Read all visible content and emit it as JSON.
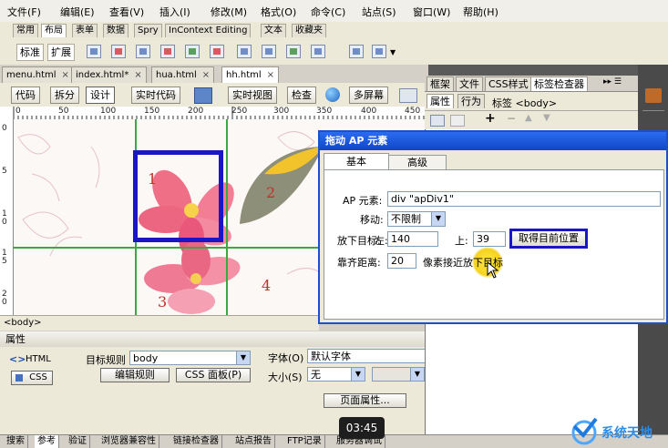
{
  "menu": [
    "文件(F)",
    "编辑(E)",
    "查看(V)",
    "插入(I)",
    "修改(M)",
    "格式(O)",
    "命令(C)",
    "站点(S)",
    "窗口(W)",
    "帮助(H)"
  ],
  "insert_tabs": [
    "常用",
    "布局",
    "表单",
    "数据",
    "Spry",
    "InContext Editing",
    "文本",
    "收藏夹"
  ],
  "layout_modes": {
    "standard": "标准",
    "expanded": "扩展"
  },
  "doc_tabs": [
    "menu.html",
    "index.html*",
    "hua.html",
    "hh.html"
  ],
  "doc_toolbar": {
    "code": "代码",
    "split": "拆分",
    "design": "设计",
    "live_code": "实时代码",
    "live_view": "实时视图",
    "inspect": "检查",
    "multiscreen": "多屏幕"
  },
  "ruler_h": [
    "0",
    "50",
    "100",
    "150",
    "200",
    "250",
    "300",
    "350",
    "400",
    "450"
  ],
  "ruler_v": [
    "0",
    "5",
    "1 0",
    "1 5",
    "2 0"
  ],
  "canvas": {
    "labels": [
      "1",
      "2",
      "3",
      "4"
    ]
  },
  "status_tag": "<body>",
  "properties": {
    "title": "属性",
    "html_btn": "HTML",
    "css_btn": "CSS",
    "target_rule_label": "目标规则",
    "target_rule_value": "body",
    "edit_rule": "编辑规则",
    "css_panel": "CSS 面板(P)",
    "font_label": "字体(O)",
    "font_value": "默认字体",
    "size_label": "大小(S)",
    "size_value": "无",
    "page_props": "页面属性..."
  },
  "bottom_tabs": [
    "搜索",
    "参考",
    "验证",
    "浏览器兼容性",
    "链接检查器",
    "站点报告",
    "FTP记录",
    "服务器调试"
  ],
  "right_panel": {
    "tabs": [
      "框架",
      "文件",
      "CSS样式",
      "标签检查器"
    ],
    "sub_tabs": [
      "属性",
      "行为"
    ],
    "tag_label": "标签 <body>"
  },
  "dialog": {
    "title": "拖动 AP 元素",
    "tabs": [
      "基本",
      "高级"
    ],
    "ap_label": "AP 元素:",
    "ap_value": "div \"apDiv1\"",
    "move_label": "移动:",
    "move_value": "不限制",
    "drop_label": "放下目标:",
    "left_label": "左:",
    "left_value": "140",
    "top_label": "上:",
    "top_value": "39",
    "get_pos": "取得目前位置",
    "snap_label": "靠齐距离:",
    "snap_value": "20",
    "snap_suffix": "像素接近放下目标"
  },
  "timer": "03:45",
  "watermark": "系统天地"
}
